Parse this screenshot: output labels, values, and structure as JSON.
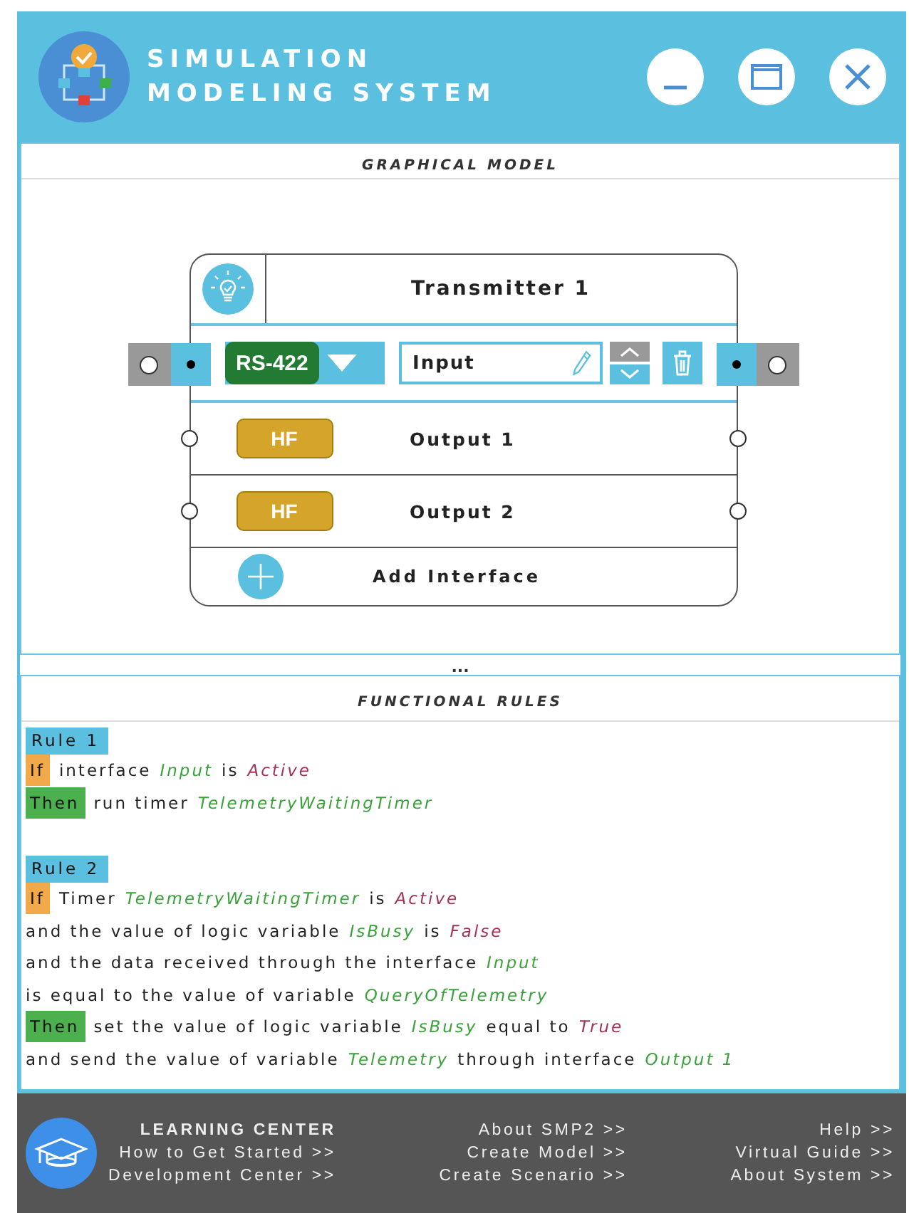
{
  "window": {
    "title_lines": [
      "SIMULATION",
      "MODELING SYSTEM"
    ]
  },
  "graphical_model": {
    "title": "GRAPHICAL MODEL",
    "node": {
      "title": "Transmitter 1",
      "interfaces": [
        {
          "kind": "editable",
          "protocol": "RS-422",
          "color": "#237a33",
          "name": "Input"
        },
        {
          "kind": "fixed",
          "protocol": "HF",
          "color": "#d4a52a",
          "name": "Output 1"
        },
        {
          "kind": "fixed",
          "protocol": "HF",
          "color": "#d4a52a",
          "name": "Output 2"
        }
      ],
      "add_label": "Add Interface"
    }
  },
  "splitter": "...",
  "functional_rules": {
    "title": "FUNCTIONAL RULES",
    "rules": [
      {
        "label": "Rule 1",
        "lines": [
          [
            {
              "kind": "if",
              "text": "If"
            },
            {
              "kind": "text",
              "text": "interface"
            },
            {
              "kind": "name",
              "text": "Input"
            },
            {
              "kind": "text",
              "text": "is"
            },
            {
              "kind": "value",
              "text": "Active"
            }
          ],
          [
            {
              "kind": "then",
              "text": "Then"
            },
            {
              "kind": "text",
              "text": "run timer"
            },
            {
              "kind": "name",
              "text": "TelemetryWaitingTimer"
            }
          ]
        ]
      },
      {
        "label": "Rule 2",
        "lines": [
          [
            {
              "kind": "if",
              "text": "If"
            },
            {
              "kind": "text",
              "text": "Timer"
            },
            {
              "kind": "name",
              "text": "TelemetryWaitingTimer"
            },
            {
              "kind": "text",
              "text": "is"
            },
            {
              "kind": "value",
              "text": "Active"
            }
          ],
          [
            {
              "kind": "text",
              "text": "and the value of logic variable"
            },
            {
              "kind": "name",
              "text": "IsBusy"
            },
            {
              "kind": "text",
              "text": "is"
            },
            {
              "kind": "value",
              "text": "False"
            }
          ],
          [
            {
              "kind": "text",
              "text": "and the data received through the interface"
            },
            {
              "kind": "name",
              "text": "Input"
            }
          ],
          [
            {
              "kind": "text",
              "text": "is equal to the value of variable"
            },
            {
              "kind": "name",
              "text": "QueryOfTelemetry"
            }
          ],
          [
            {
              "kind": "then",
              "text": "Then"
            },
            {
              "kind": "text",
              "text": "set the value of logic variable"
            },
            {
              "kind": "name",
              "text": "IsBusy"
            },
            {
              "kind": "text",
              "text": "equal to"
            },
            {
              "kind": "value",
              "text": "True"
            }
          ],
          [
            {
              "kind": "text",
              "text": "and send the value of variable"
            },
            {
              "kind": "name",
              "text": "Telemetry"
            },
            {
              "kind": "text",
              "text": "through interface"
            },
            {
              "kind": "name",
              "text": "Output 1"
            }
          ]
        ]
      }
    ]
  },
  "footer": {
    "rows": [
      [
        {
          "kind": "heading",
          "text": "LEARNING CENTER"
        },
        {
          "kind": "link",
          "text": "About SMP2 >>"
        },
        {
          "kind": "link",
          "text": "Help >>"
        }
      ],
      [
        {
          "kind": "link",
          "text": "How to Get Started >>"
        },
        {
          "kind": "link",
          "text": "Create Model >>"
        },
        {
          "kind": "link",
          "text": "Virtual Guide >>"
        }
      ],
      [
        {
          "kind": "link",
          "text": "Development Center >>"
        },
        {
          "kind": "link",
          "text": "Create Scenario >>"
        },
        {
          "kind": "link",
          "text": "About System >>"
        }
      ]
    ]
  }
}
